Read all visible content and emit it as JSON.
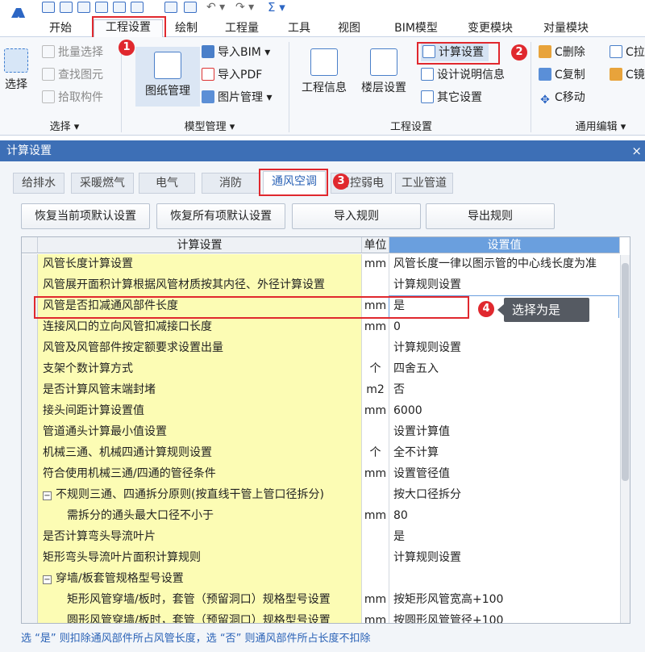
{
  "ribbon": {
    "tabs": [
      "开始",
      "工程设置",
      "绘制",
      "工程量",
      "工具",
      "视图",
      "BIM模型",
      "变更模块",
      "对量模块"
    ],
    "active_tab": "工程设置",
    "select_group": {
      "big_label": "选择",
      "items": [
        "批量选择",
        "查找图元",
        "拾取构件"
      ],
      "label": "选择"
    },
    "model_group": {
      "big_label": "图纸管理",
      "items": [
        "导入BIM",
        "导入PDF",
        "图片管理"
      ],
      "label": "模型管理"
    },
    "project_group": {
      "big1": "工程信息",
      "big2": "楼层设置",
      "items": [
        "计算设置",
        "设计说明信息",
        "其它设置"
      ],
      "label": "工程设置"
    },
    "edit_group": {
      "items": [
        "C删除",
        "C复制",
        "C移动"
      ],
      "items2": [
        "C拉",
        "C镜"
      ],
      "label": "通用编辑"
    }
  },
  "badges": [
    "1",
    "2",
    "3",
    "4"
  ],
  "dialog": {
    "title": "计算设置",
    "close": "×",
    "tabs": [
      "给排水",
      "采暖燃气",
      "电气",
      "消防",
      "通风空调",
      "智控弱电",
      "工业管道"
    ],
    "active_tab": "通风空调",
    "actions": [
      "恢复当前项默认设置",
      "恢复所有项默认设置",
      "导入规则",
      "导出规则"
    ],
    "columns": [
      "计算设置",
      "单位",
      "设置值"
    ],
    "rows": [
      {
        "name": "风管长度计算设置",
        "unit": "mm",
        "value": "风管长度一律以图示管的中心线长度为准",
        "indent": 0
      },
      {
        "name": "风管展开面积计算根据风管材质按其内径、外径计算设置",
        "unit": "",
        "value": "计算规则设置",
        "indent": 0
      },
      {
        "name": "风管是否扣减通风部件长度",
        "unit": "mm",
        "value": "是",
        "indent": 0
      },
      {
        "name": "连接风口的立向风管扣减接口长度",
        "unit": "mm",
        "value": "0",
        "indent": 0
      },
      {
        "name": "风管及风管部件按定额要求设置出量",
        "unit": "",
        "value": "计算规则设置",
        "indent": 0
      },
      {
        "name": "支架个数计算方式",
        "unit": "个",
        "value": "四舍五入",
        "indent": 0
      },
      {
        "name": "是否计算风管末端封堵",
        "unit": "m2",
        "value": "否",
        "indent": 0
      },
      {
        "name": "接头间距计算设置值",
        "unit": "mm",
        "value": "6000",
        "indent": 0
      },
      {
        "name": "管道通头计算最小值设置",
        "unit": "",
        "value": "设置计算值",
        "indent": 0
      },
      {
        "name": "机械三通、机械四通计算规则设置",
        "unit": "个",
        "value": "全不计算",
        "indent": 0
      },
      {
        "name": "符合使用机械三通/四通的管径条件",
        "unit": "mm",
        "value": "设置管径值",
        "indent": 0
      },
      {
        "name": "不规则三通、四通拆分原则(按直线干管上管口径拆分)",
        "unit": "",
        "value": "按大口径拆分",
        "indent": 0,
        "expander": "−"
      },
      {
        "name": "需拆分的通头最大口径不小于",
        "unit": "mm",
        "value": "80",
        "indent": 1
      },
      {
        "name": "是否计算弯头导流叶片",
        "unit": "",
        "value": "是",
        "indent": 0
      },
      {
        "name": "矩形弯头导流叶片面积计算规则",
        "unit": "",
        "value": "计算规则设置",
        "indent": 0
      },
      {
        "name": "穿墙/板套管规格型号设置",
        "unit": "",
        "value": "",
        "indent": 0,
        "expander": "−"
      },
      {
        "name": "矩形风管穿墙/板时，套管（预留洞口）规格型号设置",
        "unit": "mm",
        "value": "按矩形风管宽高+100",
        "indent": 1
      },
      {
        "name": "圆形风管穿墙/板时，套管（预留洞口）规格型号设置",
        "unit": "mm",
        "value": "按圆形风管管径+100",
        "indent": 1
      }
    ],
    "tooltip": "选择为是",
    "footer": "选 “是” 则扣除通风部件所占风管长度，选 “否” 则通风部件所占长度不扣除"
  }
}
